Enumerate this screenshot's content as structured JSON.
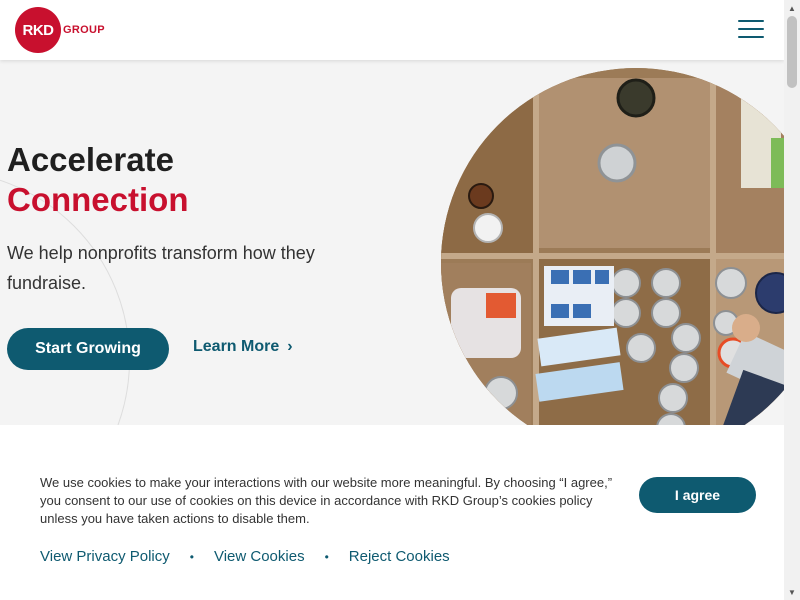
{
  "header": {
    "logo_mark": "RKD",
    "logo_word": "GROUP",
    "menu_icon": "hamburger-menu-icon"
  },
  "hero": {
    "title_line1": "Accelerate",
    "title_line2": "Connection",
    "subtitle": "We help nonprofits transform how they fundraise.",
    "primary_button": "Start Growing",
    "secondary_link": "Learn More",
    "secondary_link_icon": "chevron-right-icon",
    "image_subject": "food-donation-boxes-photo"
  },
  "cookie_banner": {
    "text": "We use cookies to make your interactions with our website more meaningful. By choosing “I agree,” you consent to our use of cookies on this device in accordance with RKD Group’s cookies policy unless you have taken actions to disable them.",
    "agree_button": "I agree",
    "links": [
      "View Privacy Policy",
      "View Cookies",
      "Reject Cookies"
    ],
    "separator": "•"
  },
  "colors": {
    "brand_red": "#c8102e",
    "brand_teal": "#0e5a70",
    "background": "#f4f4f4"
  }
}
